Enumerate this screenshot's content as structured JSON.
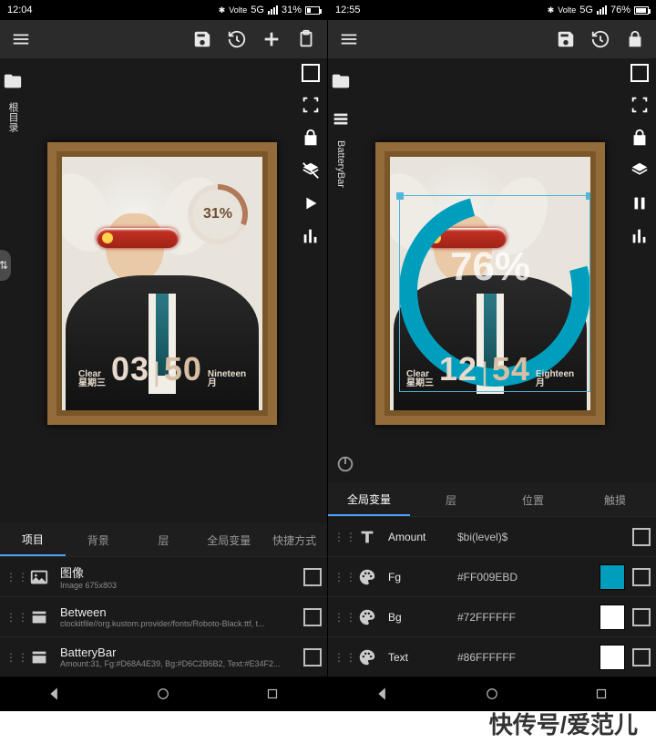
{
  "footer_label": "快传号/爱范儿",
  "left": {
    "status": {
      "time": "12:04",
      "net": "5G",
      "batt": "31%",
      "carrier": "Volte"
    },
    "sidebar_label": "根目录",
    "ring_pct": "31%",
    "clock": {
      "left_top": "Clear",
      "left_bot": "星期三",
      "hh": "03",
      "mm": "50",
      "right_top": "Nineteen",
      "right_bot": "月"
    },
    "tabs": [
      "项目",
      "背景",
      "层",
      "全局变量",
      "快捷方式"
    ],
    "active_tab": 0,
    "rows": [
      {
        "icon": "image",
        "title": "图像",
        "sub": "Image 675x803"
      },
      {
        "icon": "stack",
        "title": "Between",
        "sub": "clockitfile//org.kustom.provider/fonts/Roboto-Black.ttf, t..."
      },
      {
        "icon": "stack",
        "title": "BatteryBar",
        "sub": "Amount:31, Fg:#D68A4E39, Bg:#D6C2B6B2, Text:#E34F2..."
      }
    ]
  },
  "right": {
    "status": {
      "time": "12:55",
      "net": "5G",
      "batt": "76%",
      "carrier": "Volte"
    },
    "sidebar_label": "BatteryBar",
    "big_pct": "76%",
    "clock": {
      "left_top": "Clear",
      "left_bot": "星期三",
      "hh": "12",
      "mm": "54",
      "right_top": "Eighteen",
      "right_bot": "月"
    },
    "tabs": [
      "全局变量",
      "层",
      "位置",
      "触摸"
    ],
    "active_tab": 0,
    "rows": [
      {
        "icon": "text",
        "name": "Amount",
        "val": "$bi(level)$",
        "swatch": null
      },
      {
        "icon": "palette",
        "name": "Fg",
        "val": "#FF009EBD",
        "swatch": "#009EBD"
      },
      {
        "icon": "palette",
        "name": "Bg",
        "val": "#72FFFFFF",
        "swatch": "#FFFFFF"
      },
      {
        "icon": "palette",
        "name": "Text",
        "val": "#86FFFFFF",
        "swatch": "#FFFFFF"
      }
    ]
  }
}
